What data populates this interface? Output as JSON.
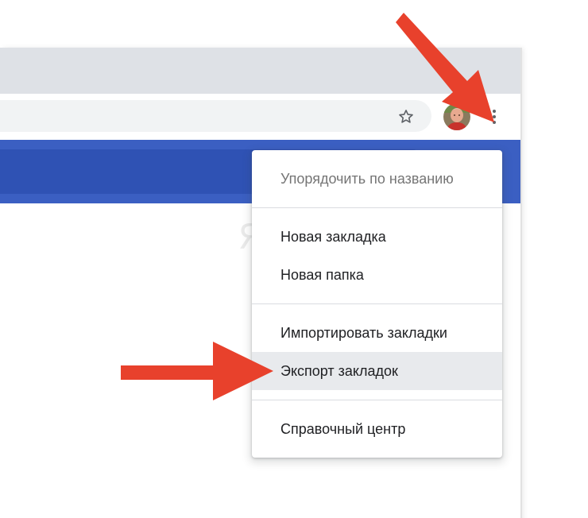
{
  "toolbar": {
    "bookmark_star_icon": "star-outline-icon",
    "avatar_icon": "user-avatar",
    "menu_icon": "three-dots-vertical-icon"
  },
  "watermark": {
    "text": "ЯБЛЫК"
  },
  "bookmarks_menu": {
    "items": [
      {
        "label": "Упорядочить по названию",
        "state": "disabled"
      },
      {
        "label": "Новая закладка",
        "state": "normal"
      },
      {
        "label": "Новая папка",
        "state": "normal"
      },
      {
        "label": "Импортировать закладки",
        "state": "normal"
      },
      {
        "label": "Экспорт закладок",
        "state": "highlighted"
      },
      {
        "label": "Справочный центр",
        "state": "normal"
      }
    ]
  },
  "annotations": {
    "arrow_color": "#e8412c",
    "arrows": [
      {
        "points_to": "menu-button"
      },
      {
        "points_to": "export-bookmarks-item"
      }
    ]
  },
  "colors": {
    "tabstrip": "#dee1e6",
    "blue_bar": "#3b5fc2",
    "menu_highlight": "#e8eaed",
    "menu_text": "#202124",
    "menu_text_disabled": "#757575"
  }
}
